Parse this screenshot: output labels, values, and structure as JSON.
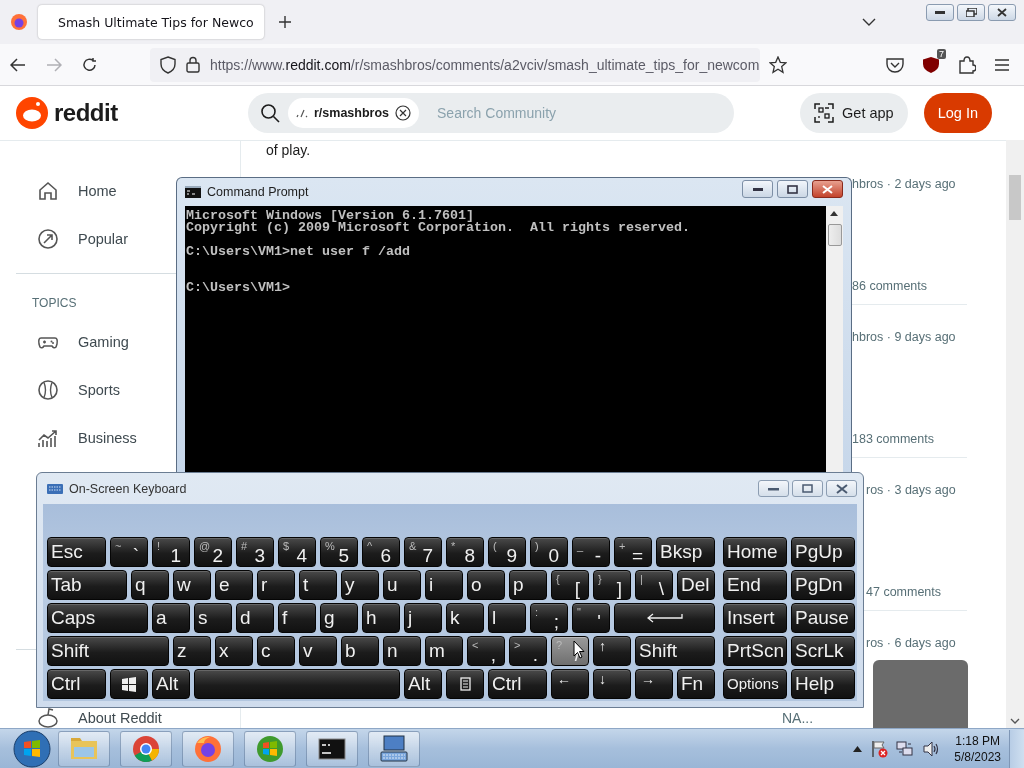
{
  "browser": {
    "tabs": [
      {
        "title": "Smash Ultimate Tips for Newco",
        "selected": true
      }
    ],
    "url": "https://www.**reddit.com**/r/smashbros/comments/a2vciv/smash_ultimate_tips_for_newcom",
    "extension_badge": "7"
  },
  "reddit": {
    "logo": "reddit",
    "search_chip": "r/smashbros",
    "search_placeholder": "Search Community",
    "get_app": "Get app",
    "login": "Log In",
    "nav": [
      {
        "label": "Home"
      },
      {
        "label": "Popular"
      }
    ],
    "topics_heading": "TOPICS",
    "topics": [
      {
        "label": "Gaming"
      },
      {
        "label": "Sports"
      },
      {
        "label": "Business"
      }
    ],
    "footer_link": "About Reddit",
    "post_snippet": "of play.",
    "side_posts": [
      {
        "meta": "hbros · 2 days ago",
        "comments": "86 comments"
      },
      {
        "meta": "hbros · 9 days ago",
        "comments": "183 comments"
      },
      {
        "meta": "ros · 3 days ago",
        "comments": "47 comments"
      },
      {
        "meta": "ros · 6 days ago"
      }
    ],
    "side_footer": "NA..."
  },
  "command_prompt": {
    "title": "Command Prompt",
    "blocks": [
      [
        "Microsoft Windows [Version 6.1.7601]",
        "Copyright (c) 2009 Microsoft Corporation.  All rights reserved."
      ],
      [
        "C:\\Users\\VM1>net user f /add"
      ],
      [
        "C:\\Users\\VM1>"
      ]
    ]
  },
  "keyboard": {
    "title": "On-Screen Keyboard",
    "keys": [
      {
        "kind": "text",
        "label": "Esc",
        "hover": false
      },
      {
        "kind": "dual",
        "shift": "~",
        "label": "`",
        "hover": false
      },
      {
        "kind": "dual",
        "shift": "!",
        "label": "1",
        "hover": false
      },
      {
        "kind": "dual",
        "shift": "@",
        "label": "2",
        "hover": false
      },
      {
        "kind": "dual",
        "shift": "#",
        "label": "3",
        "hover": false
      },
      {
        "kind": "dual",
        "shift": "$",
        "label": "4",
        "hover": false
      },
      {
        "kind": "dual",
        "shift": "%",
        "label": "5",
        "hover": false
      },
      {
        "kind": "dual",
        "shift": "^",
        "label": "6",
        "hover": false
      },
      {
        "kind": "dual",
        "shift": "&",
        "label": "7",
        "hover": false
      },
      {
        "kind": "dual",
        "shift": "*",
        "label": "8",
        "hover": false
      },
      {
        "kind": "dual",
        "shift": "(",
        "label": "9",
        "hover": false
      },
      {
        "kind": "dual",
        "shift": ")",
        "label": "0",
        "hover": false
      },
      {
        "kind": "dual",
        "shift": "_",
        "label": "-",
        "hover": false
      },
      {
        "kind": "dual",
        "shift": "+",
        "label": "=",
        "hover": false
      },
      {
        "kind": "text",
        "label": "Bksp",
        "hover": false
      },
      {
        "kind": "text",
        "label": "Tab",
        "hover": false
      },
      {
        "kind": "text",
        "label": "q",
        "hover": false
      },
      {
        "kind": "text",
        "label": "w",
        "hover": false
      },
      {
        "kind": "text",
        "label": "e",
        "hover": false
      },
      {
        "kind": "text",
        "label": "r",
        "hover": false
      },
      {
        "kind": "text",
        "label": "t",
        "hover": false
      },
      {
        "kind": "text",
        "label": "y",
        "hover": false
      },
      {
        "kind": "text",
        "label": "u",
        "hover": false
      },
      {
        "kind": "text",
        "label": "i",
        "hover": false
      },
      {
        "kind": "text",
        "label": "o",
        "hover": false
      },
      {
        "kind": "text",
        "label": "p",
        "hover": false
      },
      {
        "kind": "dual",
        "shift": "{",
        "label": "[",
        "hover": false
      },
      {
        "kind": "dual",
        "shift": "}",
        "label": "]",
        "hover": false
      },
      {
        "kind": "dual",
        "shift": "|",
        "label": "\\",
        "hover": false
      },
      {
        "kind": "text",
        "label": "Del",
        "hover": false
      },
      {
        "kind": "text",
        "label": "Caps",
        "hover": false
      },
      {
        "kind": "text",
        "label": "a",
        "hover": false
      },
      {
        "kind": "text",
        "label": "s",
        "hover": false
      },
      {
        "kind": "text",
        "label": "d",
        "hover": false
      },
      {
        "kind": "text",
        "label": "f",
        "hover": false
      },
      {
        "kind": "text",
        "label": "g",
        "hover": false
      },
      {
        "kind": "text",
        "label": "h",
        "hover": false
      },
      {
        "kind": "text",
        "label": "j",
        "hover": false
      },
      {
        "kind": "text",
        "label": "k",
        "hover": false
      },
      {
        "kind": "text",
        "label": "l",
        "hover": false
      },
      {
        "kind": "dual",
        "shift": ":",
        "label": ";",
        "hover": false
      },
      {
        "kind": "dual",
        "shift": "\"",
        "label": "'",
        "hover": false
      },
      {
        "kind": "enter",
        "hover": false
      },
      {
        "kind": "text",
        "label": "Shift",
        "hover": false
      },
      {
        "kind": "text",
        "label": "z",
        "hover": false
      },
      {
        "kind": "text",
        "label": "x",
        "hover": false
      },
      {
        "kind": "text",
        "label": "c",
        "hover": false
      },
      {
        "kind": "text",
        "label": "v",
        "hover": false
      },
      {
        "kind": "text",
        "label": "b",
        "hover": false
      },
      {
        "kind": "text",
        "label": "n",
        "hover": false
      },
      {
        "kind": "text",
        "label": "m",
        "hover": false
      },
      {
        "kind": "dual",
        "shift": "<",
        "label": ",",
        "hover": false
      },
      {
        "kind": "dual",
        "shift": ">",
        "label": ".",
        "hover": false
      },
      {
        "kind": "dual",
        "shift": "?",
        "label": "/",
        "hover": true
      },
      {
        "kind": "small",
        "label": "↑",
        "hover": false
      },
      {
        "kind": "text",
        "label": "Shift",
        "hover": false
      },
      {
        "kind": "text",
        "label": "Ctrl",
        "hover": false
      },
      {
        "kind": "win",
        "hover": false
      },
      {
        "kind": "text",
        "label": "Alt",
        "hover": false
      },
      {
        "kind": "space",
        "hover": false
      },
      {
        "kind": "text",
        "label": "Alt",
        "hover": false
      },
      {
        "kind": "menu",
        "hover": false
      },
      {
        "kind": "text",
        "label": "Ctrl",
        "hover": false
      },
      {
        "kind": "small",
        "label": "←",
        "hover": false
      },
      {
        "kind": "small",
        "label": "↓",
        "hover": false
      },
      {
        "kind": "small",
        "label": "→",
        "hover": false
      },
      {
        "kind": "text",
        "label": "Fn",
        "hover": false
      }
    ],
    "side_keys": [
      {
        "kind": "text",
        "label": "Home",
        "hover": false
      },
      {
        "kind": "text",
        "label": "PgUp",
        "hover": false
      },
      {
        "kind": "text",
        "label": "End",
        "hover": false
      },
      {
        "kind": "text",
        "label": "PgDn",
        "hover": false
      },
      {
        "kind": "text",
        "label": "Insert",
        "hover": false
      },
      {
        "kind": "text",
        "label": "Pause",
        "hover": false
      },
      {
        "kind": "text",
        "label": "PrtScn",
        "hover": false
      },
      {
        "kind": "text",
        "label": "ScrLk",
        "hover": false
      },
      {
        "kind": "smalltext",
        "label": "Options",
        "hover": false
      },
      {
        "kind": "text",
        "label": "Help",
        "hover": false
      }
    ]
  },
  "taskbar": {
    "buttons": [
      {
        "kind": "folder"
      },
      {
        "kind": "chrome"
      },
      {
        "kind": "firefox"
      },
      {
        "kind": "media"
      },
      {
        "kind": "console"
      },
      {
        "kind": "keyboard"
      }
    ],
    "time": "1:18 PM",
    "date": "5/8/2023"
  }
}
